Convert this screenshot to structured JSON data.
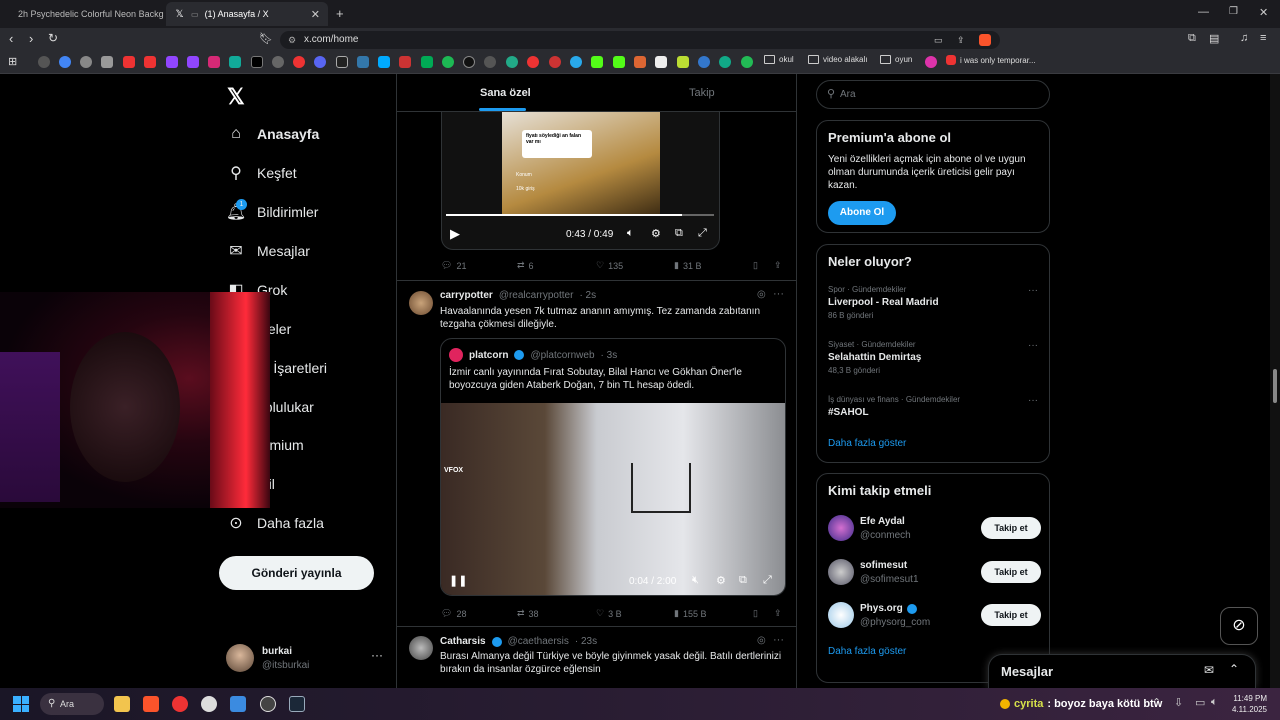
{
  "browser": {
    "tabs": [
      {
        "title": "2h Psychedelic Colorful Neon Backgr"
      },
      {
        "title": "(1) Anasayfa / X"
      }
    ],
    "url": "x.com/home",
    "bookmarks": {
      "folders": [
        "okul",
        "video alakalı",
        "oyun"
      ],
      "last": "i was only temporar..."
    },
    "colors": {
      "tabbar": "#1b1b1f",
      "toolbar": "#2a2b30"
    }
  },
  "nav": {
    "items": [
      {
        "label": "Anasayfa",
        "icon": "home-icon",
        "bold": true
      },
      {
        "label": "Keşfet",
        "icon": "search-icon"
      },
      {
        "label": "Bildirimler",
        "icon": "bell-icon",
        "badge": "1"
      },
      {
        "label": "Mesajlar",
        "icon": "mail-icon"
      },
      {
        "label": "Grok",
        "icon": "grok-icon"
      },
      {
        "label": "steler",
        "icon": "list-icon"
      },
      {
        "label": "er İşaretleri",
        "icon": "bookmark-icon"
      },
      {
        "label": "oplulukar",
        "icon": "community-icon"
      },
      {
        "label": "remium",
        "icon": "x-icon"
      },
      {
        "label": "ofil",
        "icon": "profile-icon"
      },
      {
        "label": "Daha fazla",
        "icon": "more-circle-icon"
      }
    ],
    "post_button": "Gönderi yayınla",
    "account": {
      "name": "burkai",
      "handle": "@itsburkai"
    }
  },
  "feed": {
    "tabs": [
      "Sana özel",
      "Takip"
    ],
    "tweet0": {
      "video_time": "0:43 / 0:49",
      "stats": {
        "replies": "21",
        "reposts": "6",
        "likes": "135",
        "views": "31 B"
      },
      "overlay": {
        "comment": "fiyatı söylediği an falan var mı",
        "location": "Konum",
        "views": "10k giriş"
      }
    },
    "tweet1": {
      "name": "carrypotter",
      "handle": "@realcarrypotter",
      "time": "· 2s",
      "text": "Havaalanında yesen 7k tutmaz ananın amıymış. Tez zamanda zabıtanın tezgaha çökmesi dileğiyle.",
      "quote": {
        "name": "platcorn",
        "handle": "@platcornweb",
        "time": "· 3s",
        "text": "İzmir canlı yayınında Fırat Sobutay, Bilal Hancı ve Gökhan Öner'le boyozcuya giden Ataberk Doğan, 7 bin TL hesap ödedi."
      },
      "video_time": "0:04 / 2:00",
      "stats": {
        "replies": "28",
        "reposts": "38",
        "likes": "3 B",
        "views": "155 B"
      }
    },
    "tweet2": {
      "name": "Catharsis",
      "handle": "@caethaersis",
      "time": "· 23s",
      "text": "Burası Almanya değil Türkiye ve böyle giyinmek yasak değil. Batılı dertlerinizi bırakın da insanlar özgürce eğlensin"
    }
  },
  "right": {
    "search_placeholder": "Ara",
    "premium": {
      "title": "Premium'a abone ol",
      "text": "Yeni özellikleri açmak için abone ol ve uygun olman durumunda içerik üreticisi gelir payı kazan.",
      "button": "Abone Ol"
    },
    "trends": {
      "title": "Neler oluyor?",
      "items": [
        {
          "category": "Spor · Gündemdekiler",
          "topic": "Liverpool - Real Madrid",
          "count": "86 B gönderi"
        },
        {
          "category": "Siyaset · Gündemdekiler",
          "topic": "Selahattin Demirtaş",
          "count": "48,3 B gönderi"
        },
        {
          "category": "İş dünyası ve finans · Gündemdekiler",
          "topic": "#SAHOL",
          "count": ""
        }
      ],
      "more": "Daha fazla göster"
    },
    "who_to_follow": {
      "title": "Kimi takip etmeli",
      "items": [
        {
          "name": "Efe Aydal",
          "handle": "@conmech",
          "button": "Takip et"
        },
        {
          "name": "sofimesut",
          "handle": "@sofimesut1",
          "button": "Takip et"
        },
        {
          "name": "Phys.org",
          "handle": "@physorg_com",
          "button": "Takip et"
        }
      ],
      "more": "Daha fazla göster"
    },
    "messages": "Mesajlar"
  },
  "taskbar": {
    "search": "Ara",
    "chat": {
      "user": "cyrita",
      "message": ": boyoz baya kötü btw"
    },
    "time": "11:49 PM",
    "date": "4.11.2025"
  },
  "colors": {
    "accent": "#1d9bf0",
    "border": "#2f3336",
    "muted": "#71767b"
  }
}
